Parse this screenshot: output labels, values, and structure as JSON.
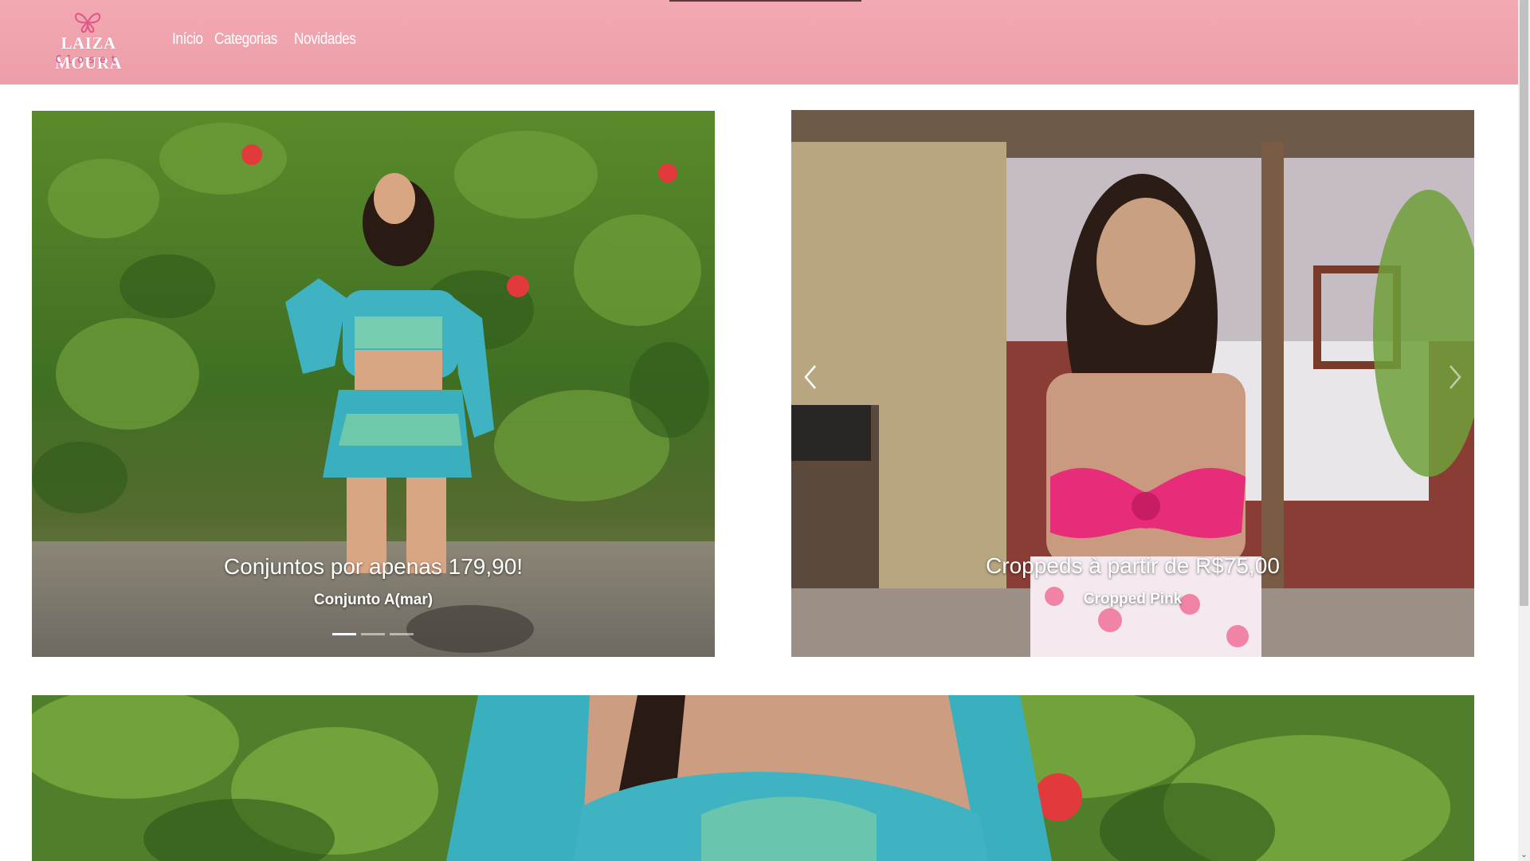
{
  "header": {
    "brand_name": "LAIZA MOURA",
    "brand_sub": "Closet",
    "nav": [
      {
        "label": "Início"
      },
      {
        "label": "Categorias"
      },
      {
        "label": "Novidades"
      }
    ],
    "bg_color": "#ee9fab"
  },
  "carousel_left": {
    "title": "Conjuntos por apenas 179,90!",
    "subtitle": "Conjunto A(mar)",
    "indicators_count": 3,
    "active_index": 0
  },
  "carousel_right": {
    "title": "Croppeds à partir de R$75,00",
    "subtitle": "Cropped Pink",
    "prev_icon": "chevron-left-icon",
    "next_icon": "chevron-right-icon"
  },
  "scrollbar": {
    "up_icon": "scroll-up-arrow-icon",
    "down_icon": "scroll-down-arrow-icon"
  }
}
